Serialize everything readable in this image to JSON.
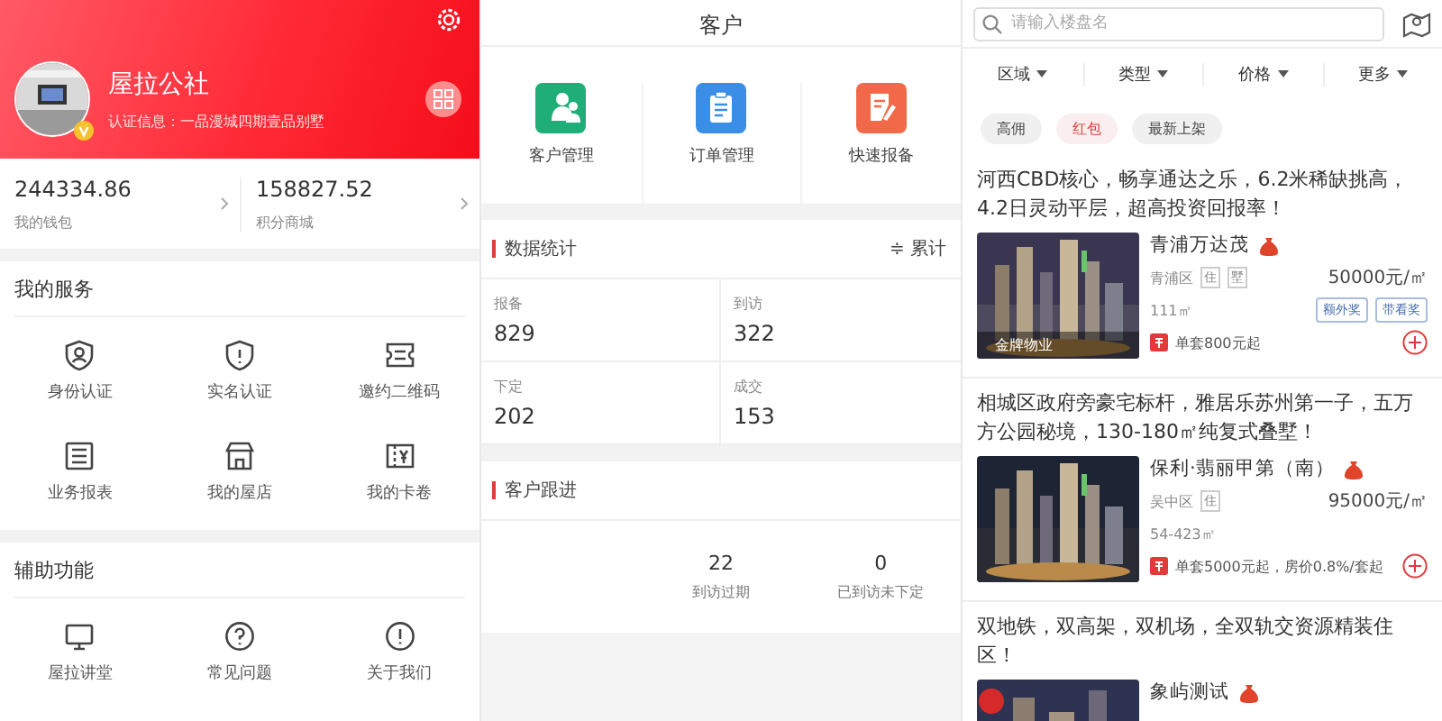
{
  "profile": {
    "name": "屋拉公社",
    "certification": "认证信息：一品漫城四期壹品别墅",
    "verified": true
  },
  "wallet": [
    {
      "amount": "244334.86",
      "label": "我的钱包"
    },
    {
      "amount": "158827.52",
      "label": "积分商城"
    }
  ],
  "services": {
    "title": "我的服务",
    "items": [
      {
        "label": "身份认证"
      },
      {
        "label": "实名认证"
      },
      {
        "label": "邀约二维码"
      },
      {
        "label": "业务报表"
      },
      {
        "label": "我的屋店"
      },
      {
        "label": "我的卡卷"
      }
    ]
  },
  "tools": {
    "title": "辅助功能",
    "items": [
      {
        "label": "屋拉讲堂"
      },
      {
        "label": "常见问题"
      },
      {
        "label": "关于我们"
      }
    ]
  },
  "customer": {
    "title": "客户",
    "shortcuts": [
      {
        "label": "客户管理",
        "color": "#1fae78"
      },
      {
        "label": "订单管理",
        "color": "#3a8ee6"
      },
      {
        "label": "快速报备",
        "color": "#f2694a"
      }
    ],
    "stats": {
      "title": "数据统计",
      "toggle": "≑ 累计",
      "items": [
        {
          "label": "报备",
          "value": "829"
        },
        {
          "label": "到访",
          "value": "322"
        },
        {
          "label": "下定",
          "value": "202"
        },
        {
          "label": "成交",
          "value": "153"
        }
      ]
    },
    "follow": {
      "title": "客户跟进",
      "items": [
        {
          "value": "22",
          "label": "到访过期"
        },
        {
          "value": "0",
          "label": "已到访未下定"
        }
      ]
    }
  },
  "listings_page": {
    "search": {
      "placeholder": "请输入楼盘名"
    },
    "filters": [
      "区域",
      "类型",
      "价格",
      "更多"
    ],
    "chips": [
      {
        "label": "高佣",
        "selected": false
      },
      {
        "label": "红包",
        "selected": true
      },
      {
        "label": "最新上架",
        "selected": false
      }
    ],
    "listings": [
      {
        "title": "河西CBD核心，畅享通达之乐，6.2米稀缺挑高，4.2日灵动平层，超高投资回报率！",
        "name": "青浦万达茂",
        "red_packet": true,
        "district": "青浦区",
        "types": [
          "住",
          "墅"
        ],
        "price": "50000元/㎡",
        "area": "111㎡",
        "rewards": [
          "额外奖",
          "带看奖"
        ],
        "rebate": "单套800元起",
        "image_caption": "金牌物业"
      },
      {
        "title": "相城区政府旁豪宅标杆，雅居乐苏州第一子，五万方公园秘境，130-180㎡纯复式叠墅！",
        "name": "保利·翡丽甲第（南）",
        "red_packet": true,
        "district": "吴中区",
        "types": [
          "住"
        ],
        "price": "95000元/㎡",
        "area": "54-423㎡",
        "rebate": "单套5000元起，房价0.8%/套起"
      },
      {
        "title": "双地铁，双高架，双机场，全双轨交资源精装住区！",
        "name": "象屿测试",
        "red_packet": true
      }
    ]
  }
}
